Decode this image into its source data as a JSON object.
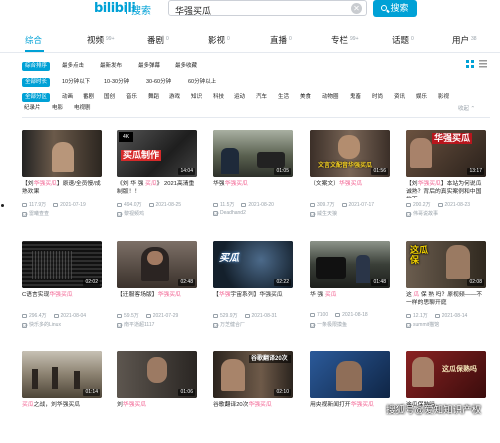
{
  "header": {
    "logo_text": "bilibili",
    "logo_sub": "搜索",
    "search_value": "华强买瓜",
    "search_button": "搜索"
  },
  "tabs": [
    {
      "label": "综合",
      "count": ""
    },
    {
      "label": "视频",
      "count": "99+"
    },
    {
      "label": "番剧",
      "count": "0"
    },
    {
      "label": "影视",
      "count": "0"
    },
    {
      "label": "直播",
      "count": "0"
    },
    {
      "label": "专栏",
      "count": "99+"
    },
    {
      "label": "话题",
      "count": "0"
    },
    {
      "label": "用户",
      "count": "38"
    }
  ],
  "filters": {
    "sort": [
      "综合排序",
      "最多点击",
      "最新发布",
      "最多弹幕",
      "最多收藏"
    ],
    "duration": [
      "全部时长",
      "10分钟以下",
      "10-30分钟",
      "30-60分钟",
      "60分钟以上"
    ],
    "zones": [
      "全部分区",
      "动画",
      "番剧",
      "国创",
      "音乐",
      "舞蹈",
      "游戏",
      "知识",
      "科技",
      "运动",
      "汽车",
      "生活",
      "美食",
      "动物圈",
      "鬼畜",
      "时尚",
      "资讯",
      "娱乐",
      "影视"
    ],
    "zones2": [
      "纪录片",
      "电影",
      "电视剧"
    ],
    "fold_label": "收起 ⌃"
  },
  "videos": [
    {
      "title_pre": "【刘",
      "hl": "华强买瓜",
      "title_post": "】原速/全员慢/成熟欢果",
      "views": "117.9万",
      "date": "2021-07-19",
      "uploader": "雷曦查查",
      "duration": "",
      "caption": ""
    },
    {
      "title_pre": "《刘 华 强 ",
      "hl": "买瓜",
      "title_post": "》 2021高清重制版！！",
      "views": "494.0万",
      "date": "2021-08-25",
      "uploader": "黎视频鸡",
      "duration": "14:04",
      "caption": "买瓜制作"
    },
    {
      "title_pre": "华强",
      "hl": "华强买瓜",
      "title_post": "",
      "views": "11.5万",
      "date": "2021-08-20",
      "uploader": "Deadhand2",
      "duration": "01:05",
      "caption": ""
    },
    {
      "title_pre": "（文案文）",
      "hl": "华强买瓜",
      "title_post": "",
      "views": "309.7万",
      "date": "2021-07-17",
      "uploader": "威生天狼",
      "duration": "01:56",
      "caption": "文言文配音华强买瓜"
    },
    {
      "title_pre": "【刘",
      "hl": "华强买瓜",
      "title_post": "】本站为何说瓜诚熟？背后的真实案例和中国地下",
      "views": "200.2万",
      "date": "2021-08-23",
      "uploader": "伟哥说故事",
      "duration": "13:17",
      "caption": "华强买瓜"
    },
    {
      "title_pre": "C语言实现",
      "hl": "华强买瓜",
      "title_post": "",
      "views": "296.4万",
      "date": "2021-08-04",
      "uploader": "快乐多的Linux",
      "duration": "02:02",
      "caption": ""
    },
    {
      "title_pre": "【迁服客场版】",
      "hl": "华强买瓜",
      "title_post": "",
      "views": "59.5万",
      "date": "2021-07-29",
      "uploader": "南平逝超1117",
      "duration": "02:48",
      "caption": ""
    },
    {
      "title_pre": "【",
      "hl": "华强",
      "title_post": "宇宙系列】华强买瓜",
      "views": "529.9万",
      "date": "2021-08-31",
      "uploader": "万芝健合厂",
      "duration": "02:22",
      "caption": "买瓜"
    },
    {
      "title_pre": "华 强 ",
      "hl": "买瓜",
      "title_post": "",
      "views": "7100",
      "date": "2021-08-18",
      "uploader": "一条极限摸鱼",
      "duration": "01:48",
      "caption": ""
    },
    {
      "title_pre": "这 ",
      "hl": "瓜",
      "title_post": " 保 熟 吗？原视频——不一样的思聊开庭",
      "views": "12.1万",
      "date": "2021-08-14",
      "uploader": "summit猫馆",
      "duration": "02:08",
      "caption": "这瓜保"
    },
    {
      "title_pre": "",
      "hl": "买瓜",
      "title_post": "之战，刘华强买瓜",
      "views": "",
      "date": "",
      "uploader": "",
      "duration": "01:14",
      "caption": ""
    },
    {
      "title_pre": "刘",
      "hl": "华强买瓜",
      "title_post": "",
      "views": "",
      "date": "",
      "uploader": "",
      "duration": "01:06",
      "caption": ""
    },
    {
      "title_pre": "谷歌翻译20次",
      "hl": "华强买瓜",
      "title_post": "",
      "views": "",
      "date": "",
      "uploader": "",
      "duration": "02:10",
      "caption": "谷歌翻译20次"
    },
    {
      "title_pre": "用央视新闻打开",
      "hl": "华强买瓜",
      "title_post": "",
      "views": "",
      "date": "",
      "uploader": "",
      "duration": "",
      "caption": ""
    },
    {
      "title_pre": "这瓜保熟吗",
      "hl": "",
      "title_post": "",
      "views": "",
      "date": "",
      "uploader": "",
      "duration": "",
      "caption": "这瓜保熟吗"
    }
  ],
  "watermark": "搜狐号@爱知知识产权",
  "colors": {
    "accent": "#00a1d6",
    "highlight": "#f25d8e",
    "meta": "#99a2aa"
  }
}
